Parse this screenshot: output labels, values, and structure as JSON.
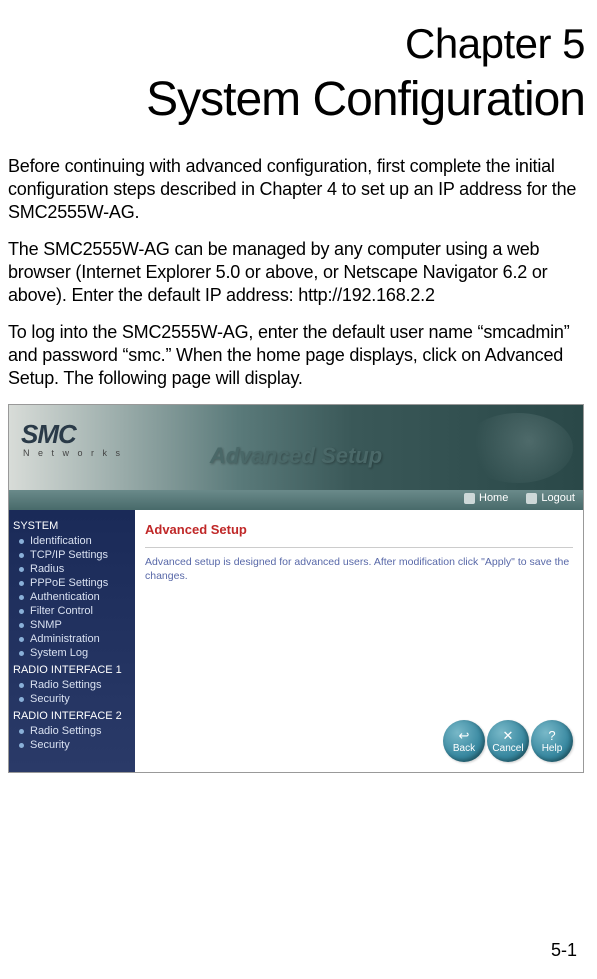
{
  "chapter_label": "Chapter 5",
  "chapter_title": "System Configuration",
  "paragraphs": {
    "p1": "Before continuing with advanced configuration, first complete the initial configuration steps described in Chapter 4 to set up an IP address for the SMC2555W-AG.",
    "p2": "The SMC2555W-AG can be managed by any computer using a web browser (Internet Explorer 5.0 or above, or Netscape Navigator 6.2 or above). Enter the default IP address: http://192.168.2.2",
    "p3": "To log into the SMC2555W-AG, enter the default user name “smcadmin” and password “smc.” When the home page displays, click on Advanced Setup. The following page will display."
  },
  "page_number": "5-1",
  "ui": {
    "logo": {
      "brand": "SMC",
      "sub": "N e t w o r k s"
    },
    "header_title": "Advanced Setup",
    "tabs": {
      "home": "Home",
      "logout": "Logout"
    },
    "sidebar": {
      "system_head": "SYSTEM",
      "system_items": [
        "Identification",
        "TCP/IP Settings",
        "Radius",
        "PPPoE Settings",
        "Authentication",
        "Filter Control",
        "SNMP",
        "Administration",
        "System Log"
      ],
      "ri1_head": "RADIO INTERFACE 1",
      "ri1_items": [
        "Radio Settings",
        "Security"
      ],
      "ri2_head": "RADIO INTERFACE 2",
      "ri2_items": [
        "Radio Settings",
        "Security"
      ]
    },
    "content": {
      "title": "Advanced Setup",
      "desc": "Advanced setup is designed for advanced users. After modification click \"Apply\" to save the changes."
    },
    "buttons": {
      "back": "Back",
      "cancel": "Cancel",
      "help": "Help"
    }
  }
}
